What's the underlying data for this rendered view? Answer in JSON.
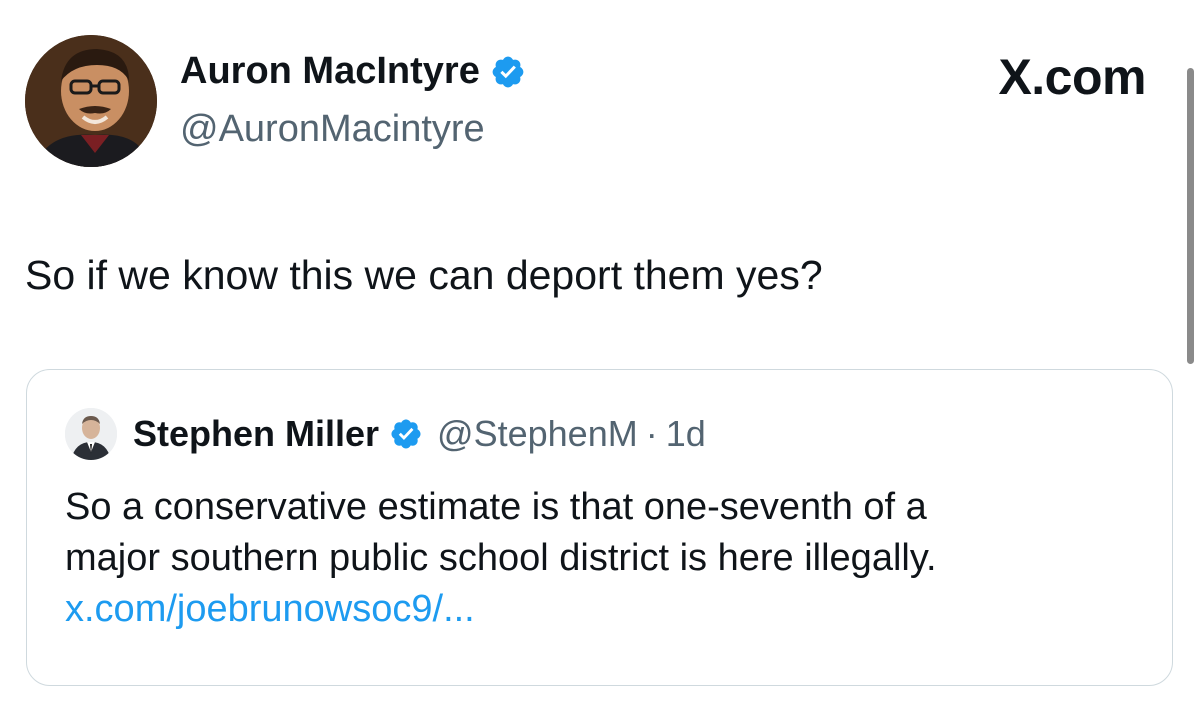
{
  "tweet": {
    "author": {
      "display_name": "Auron MacIntyre",
      "handle": "@AuronMacintyre",
      "verified": true,
      "avatar_icon": "person-avatar"
    },
    "site_brand": "X.com",
    "text": "So if we know this we can deport them yes?"
  },
  "quoted_tweet": {
    "author": {
      "display_name": "Stephen Miller",
      "handle": "@StephenM",
      "verified": true,
      "avatar_icon": "person-avatar"
    },
    "separator": "·",
    "time": "1d",
    "text_lines": [
      "So a conservative estimate is that one-seventh of a",
      "major southern public school district is here illegally."
    ],
    "link": "x.com/joebrunowsoc9/..."
  },
  "colors": {
    "text_primary": "#0f1419",
    "text_secondary": "#536471",
    "link": "#1d9bf0",
    "verified_badge": "#1d9bf0",
    "card_border": "#cfd9de"
  }
}
